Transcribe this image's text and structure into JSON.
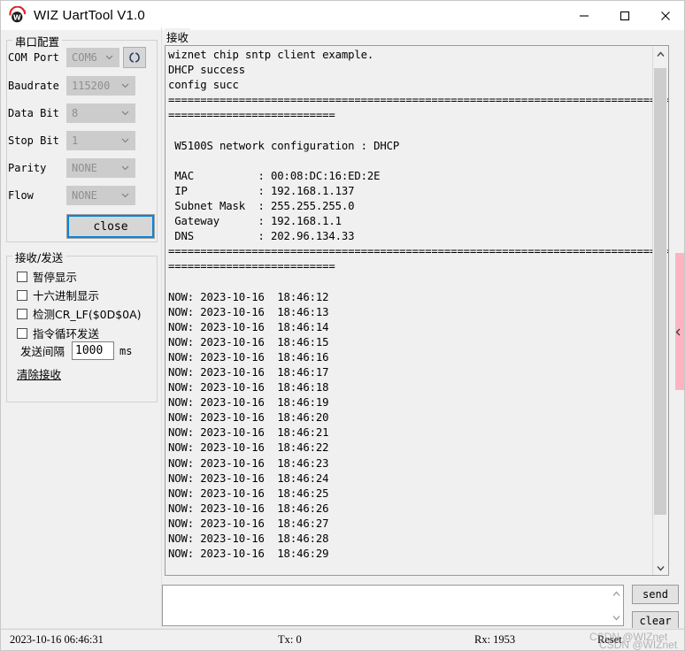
{
  "window": {
    "title": "WIZ UartTool V1.0",
    "logo_icon": "wiz-w-logo-icon",
    "controls": [
      {
        "name": "minimize",
        "icon": "minimize-icon"
      },
      {
        "name": "maximize",
        "icon": "maximize-icon"
      },
      {
        "name": "close",
        "icon": "close-icon"
      }
    ]
  },
  "serial_config": {
    "title": "串口配置",
    "refresh_icon": "refresh-ports-icon",
    "fields": [
      {
        "label": "COM Port",
        "value": "COM6"
      },
      {
        "label": "Baudrate",
        "value": "115200"
      },
      {
        "label": "Data Bit",
        "value": "8"
      },
      {
        "label": "Stop Bit",
        "value": "1"
      },
      {
        "label": "Parity",
        "value": "NONE"
      },
      {
        "label": "Flow",
        "value": "NONE"
      }
    ],
    "connect_button": "close"
  },
  "rxtx": {
    "title": "接收/发送",
    "checkboxes": [
      {
        "label": "暂停显示",
        "checked": false
      },
      {
        "label": "十六进制显示",
        "checked": false
      },
      {
        "label": "检测CR_LF($0D$0A)",
        "checked": false
      },
      {
        "label": "指令循环发送",
        "checked": false
      }
    ],
    "interval_label": "发送间隔",
    "interval_value": "1000",
    "interval_unit": "ms",
    "clear_rx_link": "清除接收"
  },
  "receive": {
    "title": "接收",
    "terminal_text": "wiznet chip sntp client example.\nDHCP success\nconfig succ\n============================================================================================\n==========================\n\n W5100S network configuration : DHCP\n\n MAC          : 00:08:DC:16:ED:2E\n IP           : 192.168.1.137\n Subnet Mask  : 255.255.255.0\n Gateway      : 192.168.1.1\n DNS          : 202.96.134.33\n============================================================================================\n==========================\n\nNOW: 2023-10-16  18:46:12\nNOW: 2023-10-16  18:46:13\nNOW: 2023-10-16  18:46:14\nNOW: 2023-10-16  18:46:15\nNOW: 2023-10-16  18:46:16\nNOW: 2023-10-16  18:46:17\nNOW: 2023-10-16  18:46:18\nNOW: 2023-10-16  18:46:19\nNOW: 2023-10-16  18:46:20\nNOW: 2023-10-16  18:46:21\nNOW: 2023-10-16  18:46:22\nNOW: 2023-10-16  18:46:23\nNOW: 2023-10-16  18:46:24\nNOW: 2023-10-16  18:46:25\nNOW: 2023-10-16  18:46:26\nNOW: 2023-10-16  18:46:27\nNOW: 2023-10-16  18:46:28\nNOW: 2023-10-16  18:46:29",
    "scroll_up_icon": "chevron-up-icon",
    "scroll_down_icon": "chevron-down-icon"
  },
  "send": {
    "input_value": "",
    "placeholder": "",
    "send_button": "send",
    "clear_button": "clear",
    "scroll_up_icon": "chevron-up-icon",
    "scroll_down_icon": "chevron-down-icon"
  },
  "statusbar": {
    "timestamp": "2023-10-16 06:46:31",
    "tx": "Tx: 0",
    "rx": "Rx: 1953",
    "reset": "Reset"
  },
  "watermark": {
    "line1": "CSDN @WIZnet",
    "line2": "CSDN @WIZnet"
  },
  "colors": {
    "accent_blue": "#0a84d8",
    "window_bg": "#f0f0f0",
    "terminal_bg": "#f0f0f0",
    "logo_red": "#d8232a",
    "pink_strip": "#ffb3c1"
  }
}
